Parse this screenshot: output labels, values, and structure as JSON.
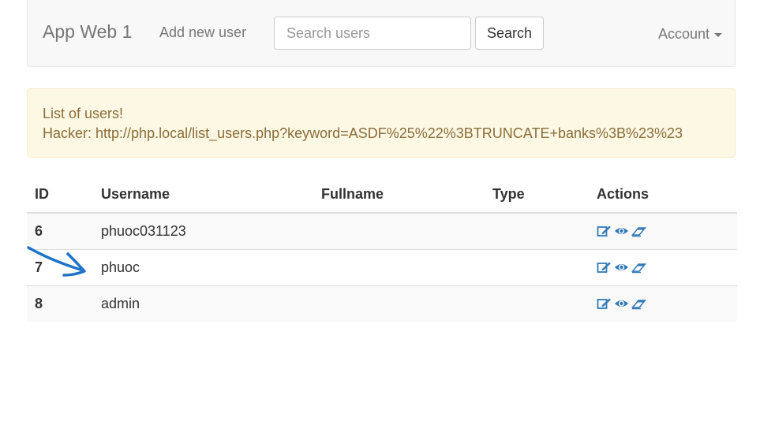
{
  "navbar": {
    "brand": "App Web 1",
    "add_user_label": "Add new user",
    "search_placeholder": "Search users",
    "search_button": "Search",
    "account_label": "Account"
  },
  "alert": {
    "line1": "List of users!",
    "line2": "Hacker: http://php.local/list_users.php?keyword=ASDF%25%22%3BTRUNCATE+banks%3B%23%23"
  },
  "table": {
    "headers": [
      "ID",
      "Username",
      "Fullname",
      "Type",
      "Actions"
    ],
    "rows": [
      {
        "id": "6",
        "username": "phuoc031123",
        "fullname": "",
        "type": ""
      },
      {
        "id": "7",
        "username": "phuoc",
        "fullname": "",
        "type": ""
      },
      {
        "id": "8",
        "username": "admin",
        "fullname": "",
        "type": ""
      }
    ],
    "action_icons": [
      "edit-icon",
      "view-icon",
      "delete-icon"
    ]
  },
  "colors": {
    "link": "#337ab7",
    "alert_bg": "#fcf8e3",
    "alert_text": "#8a6d3b",
    "annotation": "#1e73c8"
  }
}
